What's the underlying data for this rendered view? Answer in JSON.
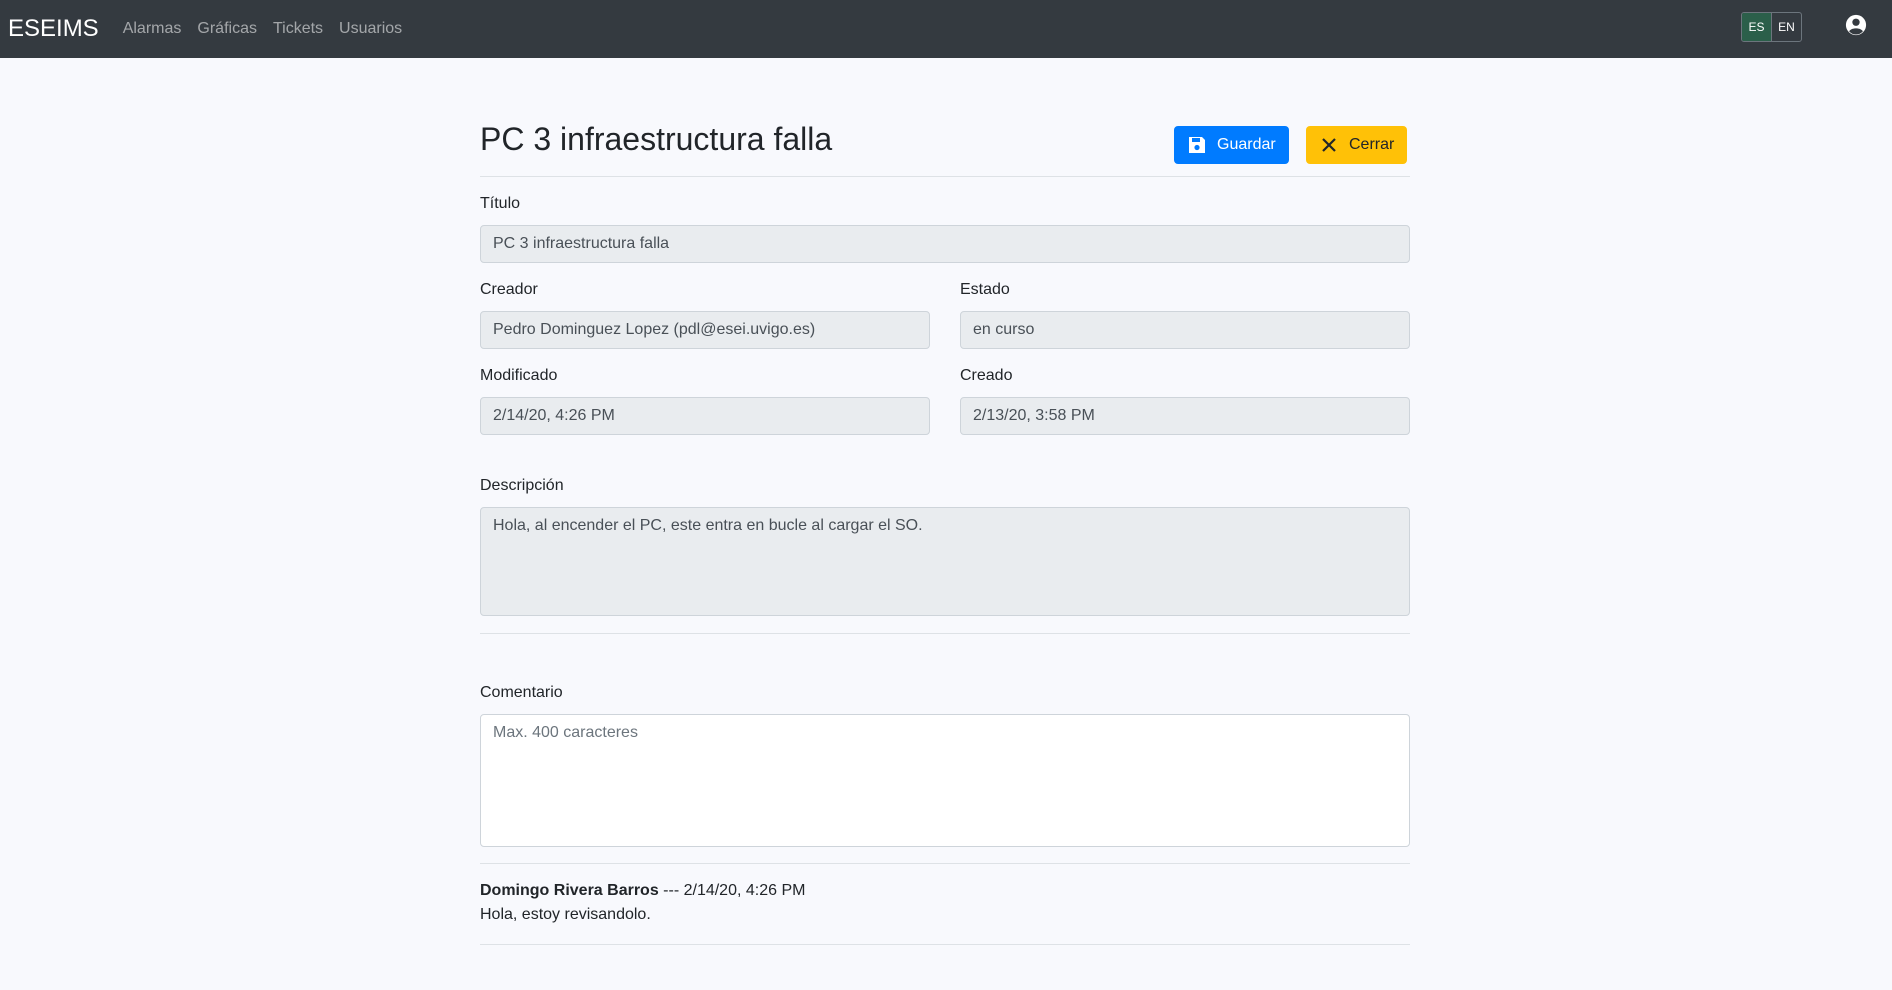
{
  "navbar": {
    "brand": "ESEIMS",
    "links": [
      "Alarmas",
      "Gráficas",
      "Tickets",
      "Usuarios"
    ],
    "languages": [
      "ES",
      "EN"
    ],
    "active_language": "ES"
  },
  "page": {
    "title": "PC 3 infraestructura falla",
    "save_label": "Guardar",
    "close_label": "Cerrar"
  },
  "form": {
    "titulo": {
      "label": "Título",
      "value": "PC 3 infraestructura falla"
    },
    "creador": {
      "label": "Creador",
      "value": "Pedro Dominguez Lopez (pdl@esei.uvigo.es)"
    },
    "estado": {
      "label": "Estado",
      "value": "en curso"
    },
    "modificado": {
      "label": "Modificado",
      "value": "2/14/20, 4:26 PM"
    },
    "creado": {
      "label": "Creado",
      "value": "2/13/20, 3:58 PM"
    },
    "descripcion": {
      "label": "Descripción",
      "value": "Hola, al encender el PC, este entra en bucle al cargar el SO."
    },
    "comentario": {
      "label": "Comentario",
      "placeholder": "Max. 400 caracteres",
      "value": ""
    }
  },
  "comments": [
    {
      "author": "Domingo Rivera Barros",
      "separator": " --- ",
      "date": "2/14/20, 4:26 PM",
      "text": "Hola, estoy revisandolo."
    }
  ],
  "colors": {
    "navbar": "#343a40",
    "primary": "#007bff",
    "warning": "#ffc107",
    "background": "#f8f9fd"
  },
  "icons": {
    "save": "floppy-disk-icon",
    "close": "x-icon",
    "user": "user-circle-icon"
  }
}
